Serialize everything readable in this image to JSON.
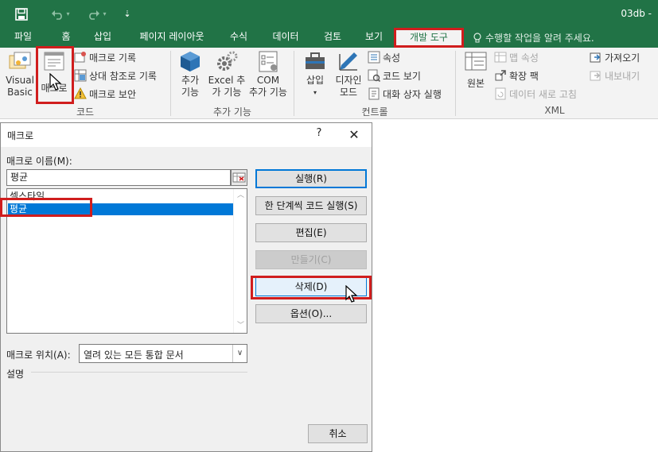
{
  "titlebar": {
    "doc_title": "03db -",
    "undo_more": "▾",
    "redo_more": "▾",
    "customize": "⇣"
  },
  "tabs": [
    {
      "label": "파일"
    },
    {
      "label": "홈"
    },
    {
      "label": "삽입"
    },
    {
      "label": "페이지 레이아웃"
    },
    {
      "label": "수식"
    },
    {
      "label": "데이터"
    },
    {
      "label": "검토"
    },
    {
      "label": "보기"
    },
    {
      "label": "개발 도구",
      "active": true
    }
  ],
  "tell_me": "수행할 작업을 알려 주세요.",
  "ribbon": {
    "code_group": {
      "label": "코드",
      "visual_basic": [
        "Visual",
        "Basic"
      ],
      "macro": "매크로",
      "record_macro": "매크로 기록",
      "relative_ref": "상대 참조로 기록",
      "macro_security": "매크로 보안"
    },
    "addins_group": {
      "label": "추가 기능",
      "addins": [
        "추가",
        "기능"
      ],
      "excel_addins": [
        "Excel 추",
        "가 기능"
      ],
      "com_addins": [
        "COM",
        "추가 기능"
      ]
    },
    "controls_group": {
      "label": "컨트롤",
      "insert": "삽입",
      "insert_arrow": "▾",
      "design_mode": [
        "디자인",
        "모드"
      ],
      "properties": "속성",
      "view_code": "코드 보기",
      "run_dialog": "대화 상자 실행"
    },
    "xml_group": {
      "label": "XML",
      "source": "원본",
      "map_properties": "맵 속성",
      "expansion_packs": "확장 팩",
      "refresh_data": "데이터 새로 고침",
      "import": "가져오기",
      "export": "내보내기"
    }
  },
  "dialog": {
    "title": "매크로",
    "help": "?",
    "close": "✕",
    "macro_name_label": "매크로 이름(M):",
    "macro_name_value": "평균",
    "list_items": [
      "셀스타일",
      "평균"
    ],
    "selected_index": 1,
    "location_label": "매크로 위치(A):",
    "location_value": "열려 있는 모든 통합 문서",
    "description_label": "설명",
    "buttons": {
      "run": "실행(R)",
      "step_into": "한 단계씩 코드 실행(S)",
      "edit": "편집(E)",
      "create": "만들기(C)",
      "delete": "삭제(D)",
      "options": "옵션(O)...",
      "cancel": "취소"
    }
  }
}
